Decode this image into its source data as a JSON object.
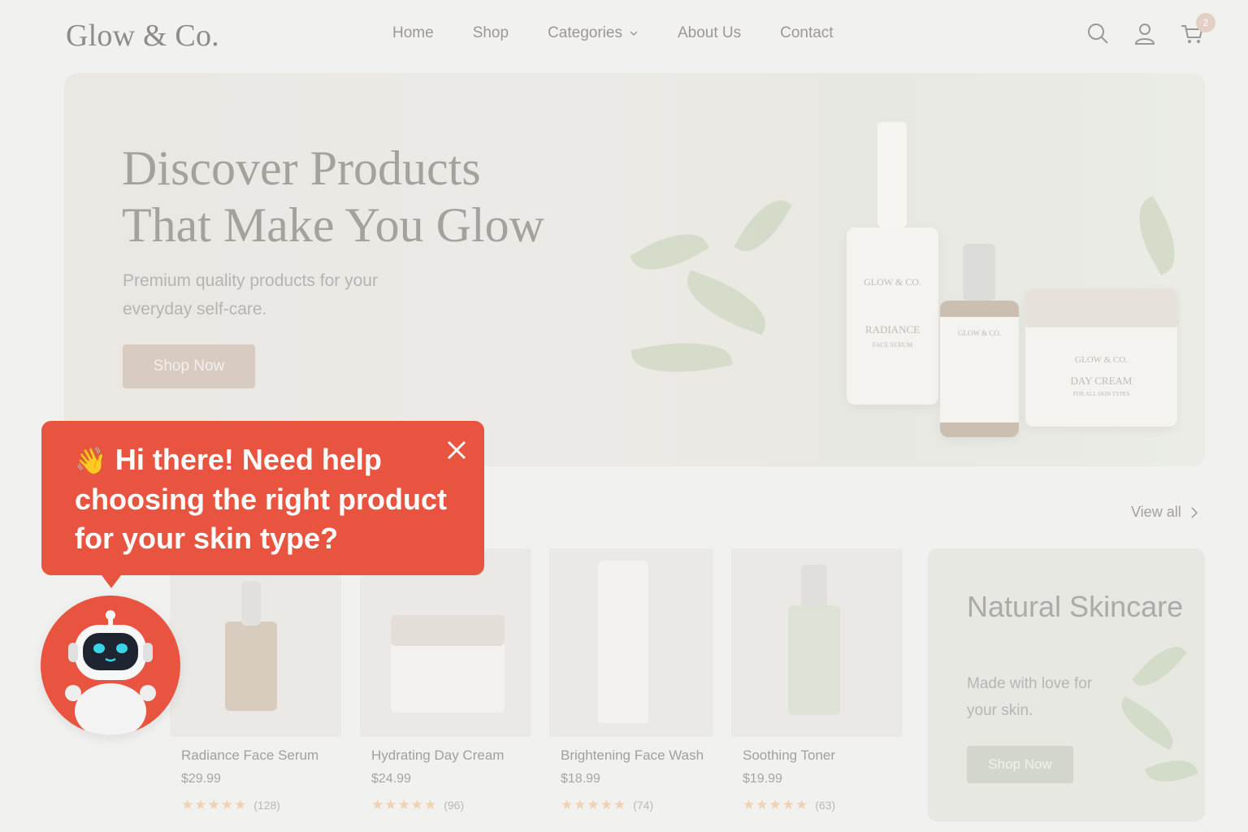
{
  "header": {
    "logo": "Glow & Co.",
    "nav": [
      "Home",
      "Shop",
      "Categories",
      "About Us",
      "Contact"
    ],
    "cart_count": "2"
  },
  "hero": {
    "title_line1": "Discover Products",
    "title_line2": "That Make You Glow",
    "subtitle": "Premium quality products for your everyday self-care.",
    "cta": "Shop Now",
    "bottles": {
      "serum_brand": "GLOW & CO.",
      "serum_name": "RADIANCE",
      "serum_type": "FACE SERUM",
      "dropper_brand": "GLOW & CO.",
      "jar_brand": "GLOW & CO.",
      "jar_name": "DAY CREAM",
      "jar_type": "FOR ALL SKIN TYPES"
    }
  },
  "products_section": {
    "view_all": "View all"
  },
  "products": [
    {
      "name": "Radiance Face Serum",
      "price": "$29.99",
      "stars": 4.5,
      "reviews": "(128)"
    },
    {
      "name": "Hydrating Day Cream",
      "price": "$24.99",
      "stars": 4.5,
      "reviews": "(96)"
    },
    {
      "name": "Brightening Face Wash",
      "price": "$18.99",
      "stars": 4.5,
      "reviews": "(74)"
    },
    {
      "name": "Soothing Toner",
      "price": "$19.99",
      "stars": 4.5,
      "reviews": "(63)"
    }
  ],
  "promo": {
    "title": "Natural Skincare",
    "subtitle": "Made with love for your skin.",
    "cta": "Shop Now"
  },
  "chat": {
    "wave_emoji": "👋",
    "message": "Hi there! Need help choosing the right product for your skin type?",
    "accent_color": "#e95440"
  },
  "icons": [
    "search-icon",
    "user-icon",
    "cart-icon",
    "chevron-down-icon",
    "chevron-right-icon",
    "close-icon",
    "robot-icon"
  ]
}
